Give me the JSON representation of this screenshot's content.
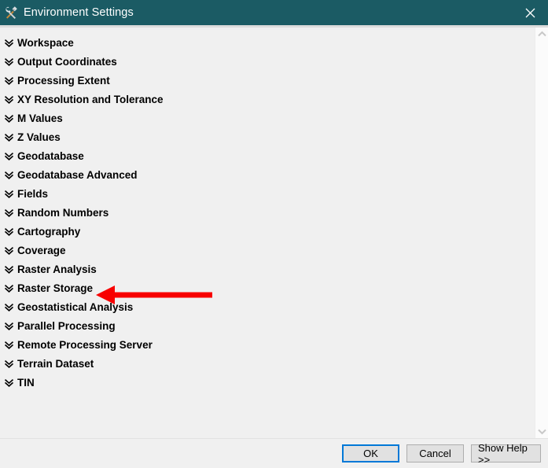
{
  "window": {
    "title": "Environment Settings",
    "icon": "tools-icon",
    "close_icon": "close-icon",
    "titlebar_color": "#1b5b64",
    "body_color": "#f0f0f0"
  },
  "categories": [
    {
      "label": "Workspace",
      "icon": "double-chevron-down-icon"
    },
    {
      "label": "Output Coordinates",
      "icon": "double-chevron-down-icon"
    },
    {
      "label": "Processing Extent",
      "icon": "double-chevron-down-icon"
    },
    {
      "label": "XY Resolution and Tolerance",
      "icon": "double-chevron-down-icon"
    },
    {
      "label": "M Values",
      "icon": "double-chevron-down-icon"
    },
    {
      "label": "Z Values",
      "icon": "double-chevron-down-icon"
    },
    {
      "label": "Geodatabase",
      "icon": "double-chevron-down-icon"
    },
    {
      "label": "Geodatabase Advanced",
      "icon": "double-chevron-down-icon"
    },
    {
      "label": "Fields",
      "icon": "double-chevron-down-icon"
    },
    {
      "label": "Random Numbers",
      "icon": "double-chevron-down-icon"
    },
    {
      "label": "Cartography",
      "icon": "double-chevron-down-icon"
    },
    {
      "label": "Coverage",
      "icon": "double-chevron-down-icon"
    },
    {
      "label": "Raster Analysis",
      "icon": "double-chevron-down-icon"
    },
    {
      "label": "Raster Storage",
      "icon": "double-chevron-down-icon"
    },
    {
      "label": "Geostatistical Analysis",
      "icon": "double-chevron-down-icon"
    },
    {
      "label": "Parallel Processing",
      "icon": "double-chevron-down-icon"
    },
    {
      "label": "Remote Processing Server",
      "icon": "double-chevron-down-icon"
    },
    {
      "label": "Terrain Dataset",
      "icon": "double-chevron-down-icon"
    },
    {
      "label": "TIN",
      "icon": "double-chevron-down-icon"
    }
  ],
  "annotation": {
    "type": "arrow",
    "direction": "left",
    "color": "#f80000",
    "points_to": "Raster Analysis"
  },
  "scrollbar": {
    "up_icon": "chevron-up-icon",
    "down_icon": "chevron-down-icon"
  },
  "footer": {
    "ok_label": "OK",
    "cancel_label": "Cancel",
    "help_label": "Show Help >>",
    "focus_color": "#0078d7"
  }
}
